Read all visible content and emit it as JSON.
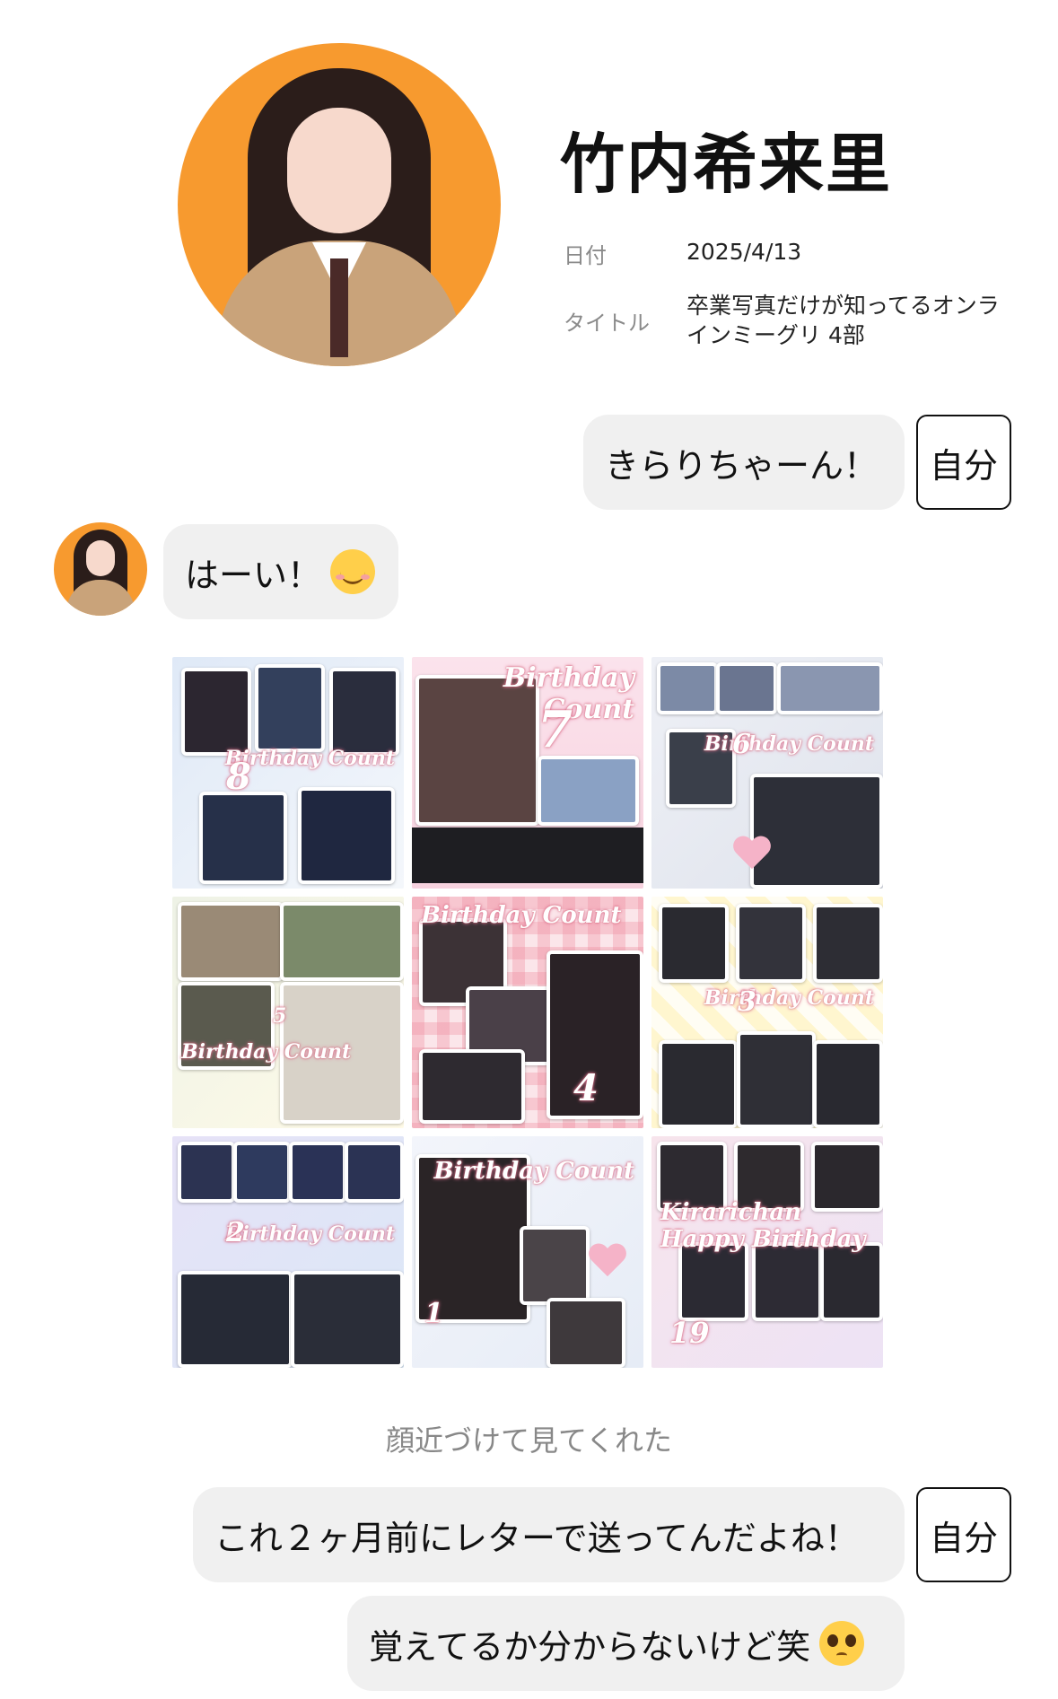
{
  "profile": {
    "name": "竹内希来里",
    "date_label": "日付",
    "date_value": "2025/4/13",
    "title_label": "タイトル",
    "title_value_line1": "卒業写真だけが知ってるオンラ",
    "title_value_line2": "インミーグリ 4部",
    "accent_color": "#f79a2f"
  },
  "chat": {
    "self_badge": "自分",
    "messages": [
      {
        "from": "self",
        "text": "きらりちゃーん！"
      },
      {
        "from": "member",
        "text": "はーい！",
        "emoji": "smiling-face-with-blush-emoji"
      },
      {
        "from": "self",
        "text": "これ２ヶ月前にレターで送ってんだよね！"
      },
      {
        "from": "self",
        "text": "覚えてるか分からないけど笑",
        "emoji": "pleading-face-emoji"
      }
    ],
    "caption": "顔近づけて見てくれた"
  },
  "collage": {
    "tiles": [
      {
        "label": "Birthday Count",
        "number": "8"
      },
      {
        "label": "Birthday Count",
        "number": "7"
      },
      {
        "label": "Birthday Count",
        "number": "6"
      },
      {
        "label": "Birthday Count",
        "number": "5"
      },
      {
        "label": "Birthday Count",
        "number": "4"
      },
      {
        "label": "Birthday Count",
        "number": "3"
      },
      {
        "label": "Birthday Count",
        "number": "2"
      },
      {
        "label": "Birthday Count",
        "number": "1"
      },
      {
        "label": "Kirarichan Happy Birthday",
        "number": "19"
      }
    ]
  }
}
